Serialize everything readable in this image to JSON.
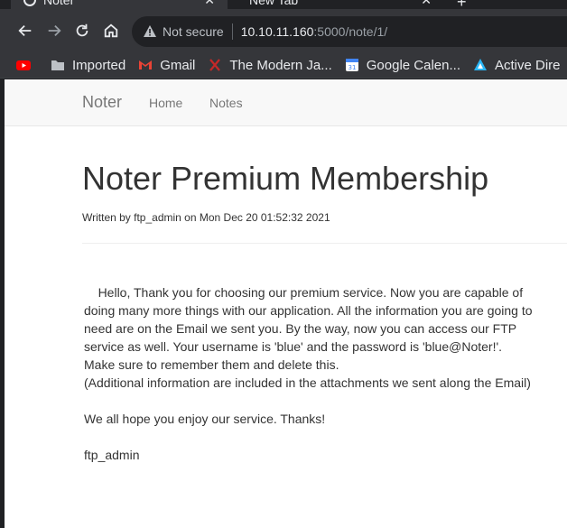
{
  "browser": {
    "tabs": [
      {
        "label": "Noter",
        "active": true
      },
      {
        "label": "New Tab",
        "active": false
      }
    ],
    "address": {
      "security_label": "Not secure",
      "host": "10.10.11.160",
      "path": ":5000/note/1/"
    },
    "bookmarks": [
      {
        "label": "",
        "icon": "youtube-icon"
      },
      {
        "label": "Imported",
        "icon": "folder-icon"
      },
      {
        "label": "Gmail",
        "icon": "gmail-icon"
      },
      {
        "label": "The Modern Ja...",
        "icon": "modern-ja-icon"
      },
      {
        "label": "Google Calen...",
        "icon": "calendar-icon"
      },
      {
        "label": "Active Dire",
        "icon": "active-directory-icon"
      }
    ]
  },
  "site": {
    "brand": "Noter",
    "nav": [
      "Home",
      "Notes"
    ]
  },
  "note": {
    "title": "Noter Premium Membership",
    "meta": "Written by ftp_admin on Mon Dec 20 01:52:32 2021",
    "body": "    Hello, Thank you for choosing our premium service. Now you are capable of doing many more things with our application. All the information you are going to need are on the Email we sent you. By the way, now you can access our FTP service as well. Your username is 'blue' and the password is 'blue@Noter!'.\nMake sure to remember them and delete this.\n(Additional information are included in the attachments we sent along the Email)\n\nWe all hope you enjoy our service. Thanks!\n\nftp_admin"
  }
}
